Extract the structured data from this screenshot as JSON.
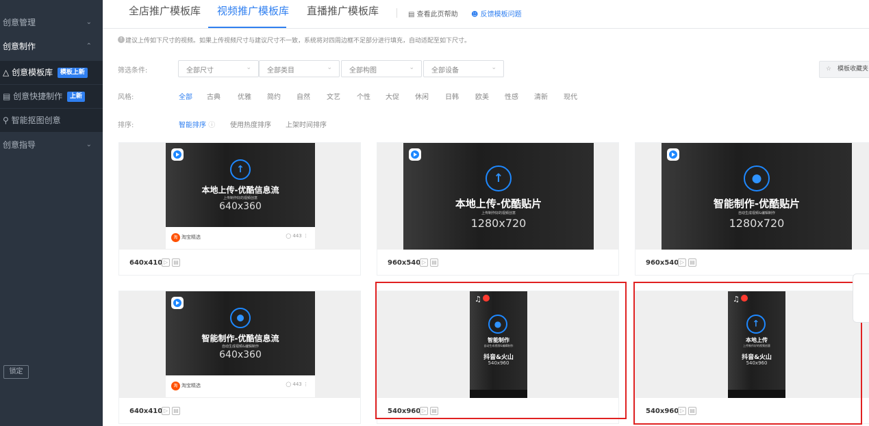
{
  "sidebar": {
    "items": [
      {
        "label": "创意管理",
        "chevron": "chevron-down-icon"
      },
      {
        "label": "创意制作",
        "chevron": "chevron-up-icon"
      },
      {
        "label": "创意模板库",
        "badge": "模板上新"
      },
      {
        "label": "创意快捷制作",
        "badge": "上新"
      },
      {
        "label": "智能抠图创意"
      },
      {
        "label": "创意指导",
        "chevron": "chevron-down-icon"
      }
    ],
    "lock_label": "锁定"
  },
  "tabs": [
    "全店推广模板库",
    "视频推广模板库",
    "直播推广模板库"
  ],
  "header_links": {
    "help": "查看此页帮助",
    "feedback": "反馈模板问题"
  },
  "tip": "建议上传如下尺寸的视频。如果上传视频尺寸与建议尺寸不一致，系统将对四周边框不足部分进行填充，自动适配至如下尺寸。",
  "filters": {
    "label": "筛选条件:",
    "selects": [
      "全部尺寸",
      "全部类目",
      "全部构图",
      "全部设备"
    ],
    "favorites": "模板收藏夹"
  },
  "style": {
    "label": "风格:",
    "options": [
      "全部",
      "古典",
      "优雅",
      "简约",
      "自然",
      "文艺",
      "个性",
      "大促",
      "休闲",
      "日韩",
      "欧美",
      "性感",
      "清新",
      "现代"
    ]
  },
  "sort": {
    "label": "排序:",
    "options": [
      "智能排序",
      "使用热度排序",
      "上架时间排序"
    ]
  },
  "cards": [
    {
      "caption": "640x410",
      "title": "本地上传-优酷信息流",
      "sub": "上传制作好的视频创意",
      "dim": "640x360",
      "shop": "淘宝精选",
      "comments": "443"
    },
    {
      "caption": "960x540",
      "title": "本地上传-优酷贴片",
      "sub": "上传制作好的视频创意",
      "dim": "1280x720"
    },
    {
      "caption": "960x540",
      "title": "智能制作-优酷贴片",
      "sub": "自动生成视频&编辑制作",
      "dim": "1280x720"
    },
    {
      "caption": "640x410",
      "title": "智能制作-优酷信息流",
      "sub": "自动生成视频&编辑制作",
      "dim": "640x360",
      "shop": "淘宝精选",
      "comments": "443"
    },
    {
      "caption": "540x960",
      "title": "智能制作",
      "sub": "自动生成视频&编辑制作",
      "title2": "抖音&火山",
      "dim": "540x960"
    },
    {
      "caption": "540x960",
      "title": "本地上传",
      "sub": "上传制作好的视频创意",
      "title2": "抖音&火山",
      "dim": "540x960"
    }
  ]
}
